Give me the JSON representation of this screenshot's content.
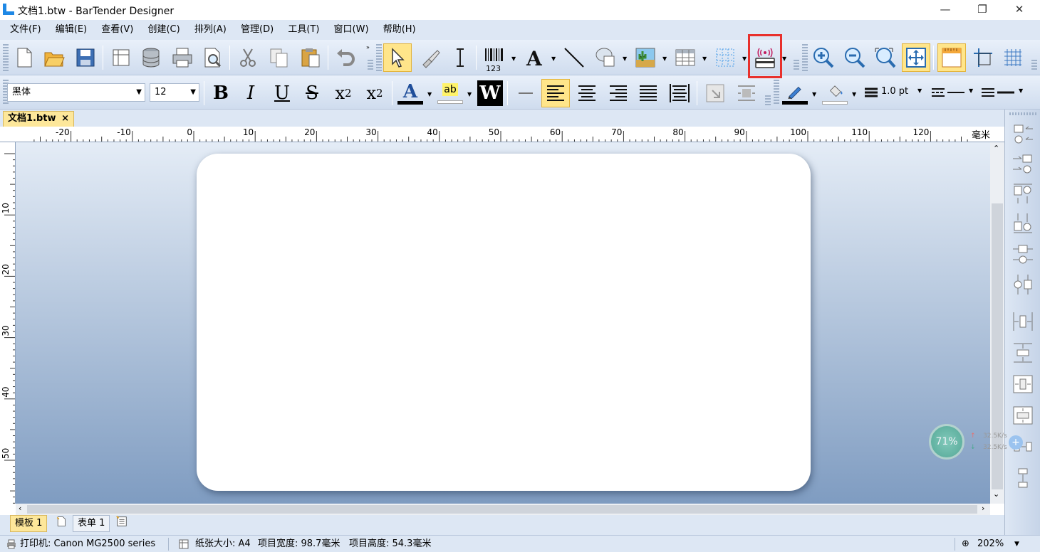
{
  "window": {
    "title": "文档1.btw - BarTender Designer",
    "minimize": "—",
    "restore": "❐",
    "close": "✕"
  },
  "menu": [
    "文件(F)",
    "编辑(E)",
    "查看(V)",
    "创建(C)",
    "排列(A)",
    "管理(D)",
    "工具(T)",
    "窗口(W)",
    "帮助(H)"
  ],
  "toolbar": {
    "barcode_caption": "123",
    "font_name": "黑体",
    "font_size": "12",
    "bold": "B",
    "italic": "I",
    "underline": "U",
    "strike": "S",
    "subscript_base": "x",
    "subscript_sub": "2",
    "superscript_base": "x",
    "superscript_sup": "2",
    "text_color_glyph": "A",
    "highlight_glyph": "ab",
    "reverse_glyph": "W",
    "line_width": "1.0 pt"
  },
  "document_tab": {
    "label": "文档1.btw",
    "close": "×"
  },
  "ruler": {
    "unit": "毫米",
    "h_ticks": [
      "-20",
      "-10",
      "0",
      "10",
      "20",
      "30",
      "40",
      "50",
      "60",
      "70",
      "80",
      "90",
      "100",
      "110",
      "120"
    ],
    "v_ticks": [
      "10",
      "20",
      "30",
      "40",
      "50"
    ]
  },
  "bottom_tabs": {
    "template": "模板 1",
    "form": "表单 1"
  },
  "status": {
    "printer": "打印机: Canon MG2500 series",
    "paper_size": "纸张大小: A4",
    "item_width": "项目宽度: 98.7毫米",
    "item_height": "项目高度: 54.3毫米",
    "zoom": "202%"
  },
  "net_monitor": {
    "percent": "71%",
    "upload": "32.5K/s",
    "download": "32.5K/s"
  },
  "colors": {
    "accent": "#e8302c",
    "tab_active": "#fde79a",
    "text_color_bar": "#1f4e9a"
  }
}
